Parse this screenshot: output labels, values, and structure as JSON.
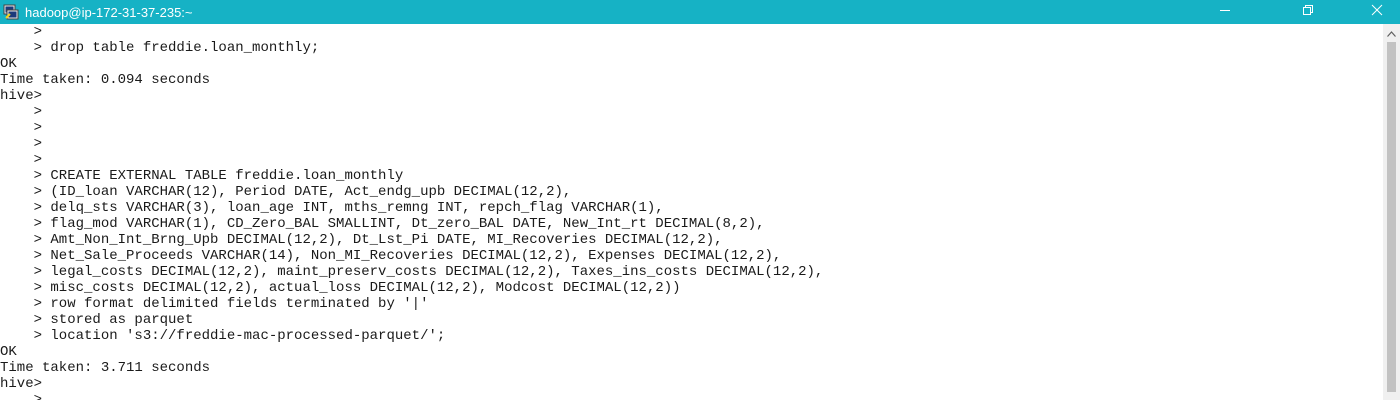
{
  "window": {
    "title": "hadoop@ip-172-31-37-235:~",
    "icons": {
      "app": "putty-terminal-icon",
      "minimize": "minimize-icon",
      "restore": "restore-icon",
      "close": "close-icon",
      "scroll_up": "scroll-up-arrow-icon"
    },
    "colors": {
      "titlebar": "#16b2c5",
      "title_text": "#ffffff",
      "terminal_bg": "#ffffff",
      "terminal_text": "#1a1a1a"
    }
  },
  "terminal": {
    "lines": [
      "    >",
      "    > drop table freddie.loan_monthly;",
      "OK",
      "Time taken: 0.094 seconds",
      "hive>",
      "    >",
      "    >",
      "    >",
      "    >",
      "    > CREATE EXTERNAL TABLE freddie.loan_monthly",
      "    > (ID_loan VARCHAR(12), Period DATE, Act_endg_upb DECIMAL(12,2),",
      "    > delq_sts VARCHAR(3), loan_age INT, mths_remng INT, repch_flag VARCHAR(1),",
      "    > flag_mod VARCHAR(1), CD_Zero_BAL SMALLINT, Dt_zero_BAL DATE, New_Int_rt DECIMAL(8,2),",
      "    > Amt_Non_Int_Brng_Upb DECIMAL(12,2), Dt_Lst_Pi DATE, MI_Recoveries DECIMAL(12,2),",
      "    > Net_Sale_Proceeds VARCHAR(14), Non_MI_Recoveries DECIMAL(12,2), Expenses DECIMAL(12,2),",
      "    > legal_costs DECIMAL(12,2), maint_preserv_costs DECIMAL(12,2), Taxes_ins_costs DECIMAL(12,2),",
      "    > misc_costs DECIMAL(12,2), actual_loss DECIMAL(12,2), Modcost DECIMAL(12,2))",
      "    > row format delimited fields terminated by '|'",
      "    > stored as parquet",
      "    > location 's3://freddie-mac-processed-parquet/';",
      "OK",
      "Time taken: 3.711 seconds",
      "hive>",
      "    >"
    ]
  }
}
